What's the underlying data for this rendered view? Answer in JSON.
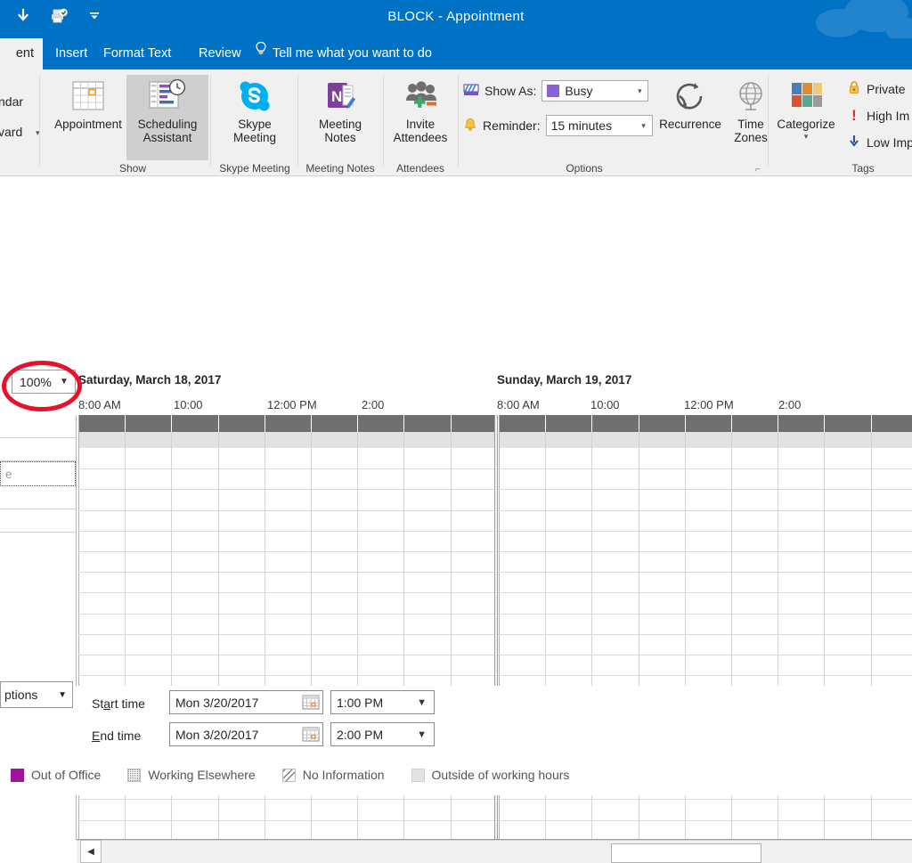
{
  "window": {
    "title": "BLOCK  -  Appointment",
    "quick_access": [
      {
        "name": "save-icon",
        "glyph": "↓"
      },
      {
        "name": "print-preview-icon",
        "glyph": "printer"
      },
      {
        "name": "customize-quick-access-toolbar-icon",
        "glyph": "⌄"
      }
    ]
  },
  "tabs": [
    {
      "label": "ent",
      "active": true,
      "name": "tab-appointment"
    },
    {
      "label": "Insert",
      "active": false,
      "name": "tab-insert"
    },
    {
      "label": "Format Text",
      "active": false,
      "name": "tab-format-text"
    },
    {
      "label": "Review",
      "active": false,
      "name": "tab-review"
    }
  ],
  "tell_me": "Tell me what you want to do",
  "ribbon": {
    "clipped_left": {
      "actions_label": "ndar",
      "forward_label": "vard"
    },
    "groups": [
      {
        "label": "Show",
        "name": "ribbon-group-show"
      },
      {
        "label": "Skype Meeting",
        "name": "ribbon-group-skype-meeting"
      },
      {
        "label": "Meeting Notes",
        "name": "ribbon-group-meeting-notes"
      },
      {
        "label": "Attendees",
        "name": "ribbon-group-attendees"
      },
      {
        "label": "Options",
        "name": "ribbon-group-options"
      },
      {
        "label": "Tags",
        "name": "ribbon-group-tags"
      }
    ],
    "buttons": {
      "appointment": "Appointment",
      "scheduling_assistant_l1": "Scheduling",
      "scheduling_assistant_l2": "Assistant",
      "skype_l1": "Skype",
      "skype_l2": "Meeting",
      "notes_l1": "Meeting",
      "notes_l2": "Notes",
      "invite_l1": "Invite",
      "invite_l2": "Attendees",
      "recurrence": "Recurrence",
      "timezones_l1": "Time",
      "timezones_l2": "Zones",
      "categorize": "Categorize"
    },
    "options": {
      "show_as_label": "Show As:",
      "show_as_value": "Busy",
      "show_as_color": "#8a62d3",
      "reminder_label": "Reminder:",
      "reminder_value": "15 minutes"
    },
    "tags": [
      {
        "label": "Private",
        "name": "tag-private"
      },
      {
        "label": "High Im",
        "name": "tag-high-importance"
      },
      {
        "label": "Low Imp",
        "name": "tag-low-importance"
      }
    ]
  },
  "scheduler": {
    "zoom_value": "100%",
    "attendee_selected_text": "e",
    "days": [
      {
        "name": "day-saturday",
        "title": "Saturday, March 18, 2017",
        "ticks": [
          "8:00 AM",
          "10:00",
          "12:00 PM",
          "2:00"
        ]
      },
      {
        "name": "day-sunday",
        "title": "Sunday, March 19, 2017",
        "ticks": [
          "8:00 AM",
          "10:00",
          "12:00 PM",
          "2:00"
        ]
      }
    ]
  },
  "form": {
    "options_button": "ptions",
    "start_time_label": "Start time",
    "start_date_value": "Mon 3/20/2017",
    "start_time_value": "1:00 PM",
    "end_time_label": "End time",
    "end_date_value": "Mon 3/20/2017",
    "end_time_value": "2:00 PM"
  },
  "legend": [
    {
      "label": "Out of Office",
      "name": "legend-out-of-office",
      "color": "#a0149b"
    },
    {
      "label": "Working Elsewhere",
      "name": "legend-working-elsewhere",
      "color": "#ffffff"
    },
    {
      "label": "No Information",
      "name": "legend-no-information",
      "color": "#ffffff"
    },
    {
      "label": "Outside of working hours",
      "name": "legend-outside-working-hours",
      "color": "#e2e2e2"
    }
  ]
}
